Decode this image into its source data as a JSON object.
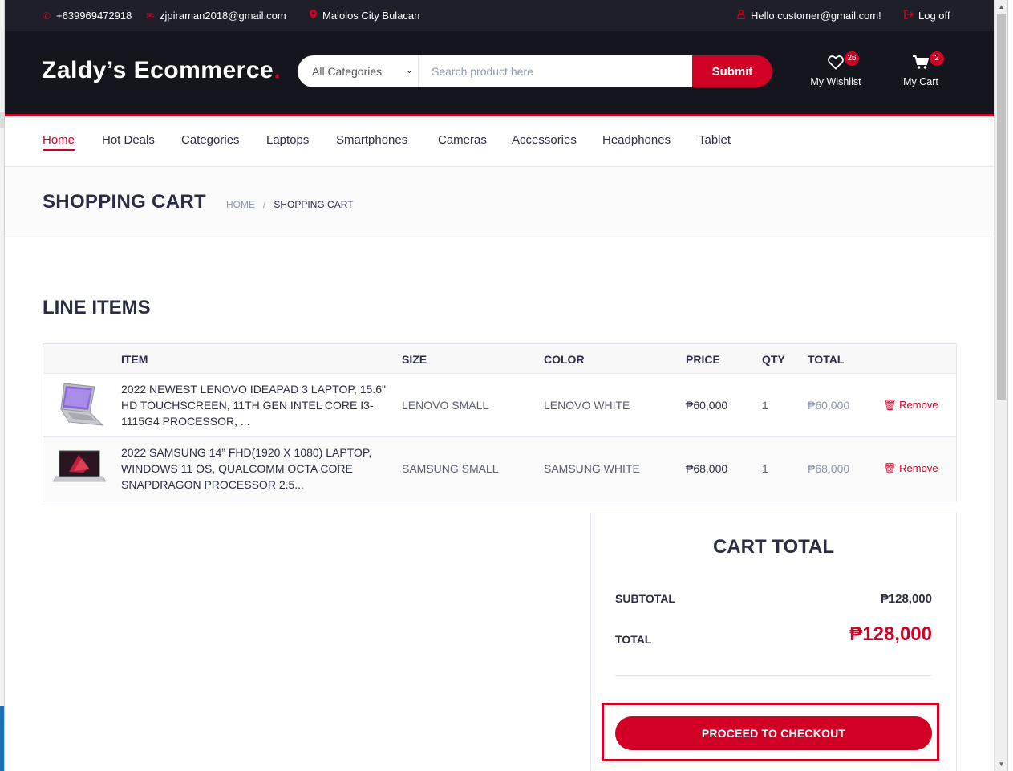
{
  "topbar": {
    "phone": "+639969472918",
    "email": "zjpiraman2018@gmail.com",
    "location": "Malolos City Bulacan",
    "greeting": "Hello customer@gmail.com!",
    "logoff": "Log off"
  },
  "header": {
    "logo_text": "Zaldy’s Ecommerce",
    "logo_dot": ".",
    "category_selected": "All Categories",
    "search_placeholder": "Search product here",
    "submit_label": "Submit",
    "wishlist_label": "My Wishlist",
    "wishlist_count": "26",
    "cart_label": "My Cart",
    "cart_count": "2"
  },
  "nav": {
    "items": [
      "Home",
      "Hot Deals",
      "Categories",
      "Laptops",
      "Smartphones",
      "Cameras",
      "Accessories",
      "Headphones",
      "Tablet"
    ],
    "active": "Home"
  },
  "breadcrumb": {
    "title": "SHOPPING CART",
    "home": "HOME",
    "separator": "/",
    "current": "SHOPPING CART"
  },
  "line_items": {
    "title": "LINE ITEMS",
    "columns": [
      "ITEM",
      "SIZE",
      "COLOR",
      "PRICE",
      "QTY",
      "TOTAL"
    ],
    "rows": [
      {
        "item": "2022 NEWEST LENOVO IDEAPAD 3 LAPTOP, 15.6\" HD TOUCHSCREEN, 11TH GEN INTEL CORE I3-1115G4 PROCESSOR, ...",
        "size": "LENOVO SMALL",
        "color": "LENOVO WHITE",
        "price": "₱60,000",
        "qty": "1",
        "total": "₱60,000",
        "remove": "Remove"
      },
      {
        "item": "2022 SAMSUNG 14” FHD(1920 X 1080) LAPTOP, WINDOWS 11 OS, QUALCOMM OCTA CORE SNAPDRAGON PROCESSOR 2.5...",
        "size": "SAMSUNG SMALL",
        "color": "SAMSUNG WHITE",
        "price": "₱68,000",
        "qty": "1",
        "total": "₱68,000",
        "remove": "Remove"
      }
    ]
  },
  "cart_total": {
    "title": "CART TOTAL",
    "subtotal_label": "SUBTOTAL",
    "subtotal_value": "₱128,000",
    "total_label": "TOTAL",
    "total_value": "₱128,000",
    "checkout_label": "PROCEED TO CHECKOUT"
  },
  "colors": {
    "accent": "#d10024",
    "header_dark": "#15161d",
    "topbar_dark": "#1e1f29",
    "text": "#2b2d42"
  },
  "icons": {
    "phone": "phone-icon",
    "email": "envelope-icon",
    "location": "map-marker-icon",
    "user": "user-icon",
    "logoff": "sign-out-icon",
    "wishlist": "heart-icon",
    "cart": "shopping-cart-icon",
    "remove": "trash-icon"
  }
}
